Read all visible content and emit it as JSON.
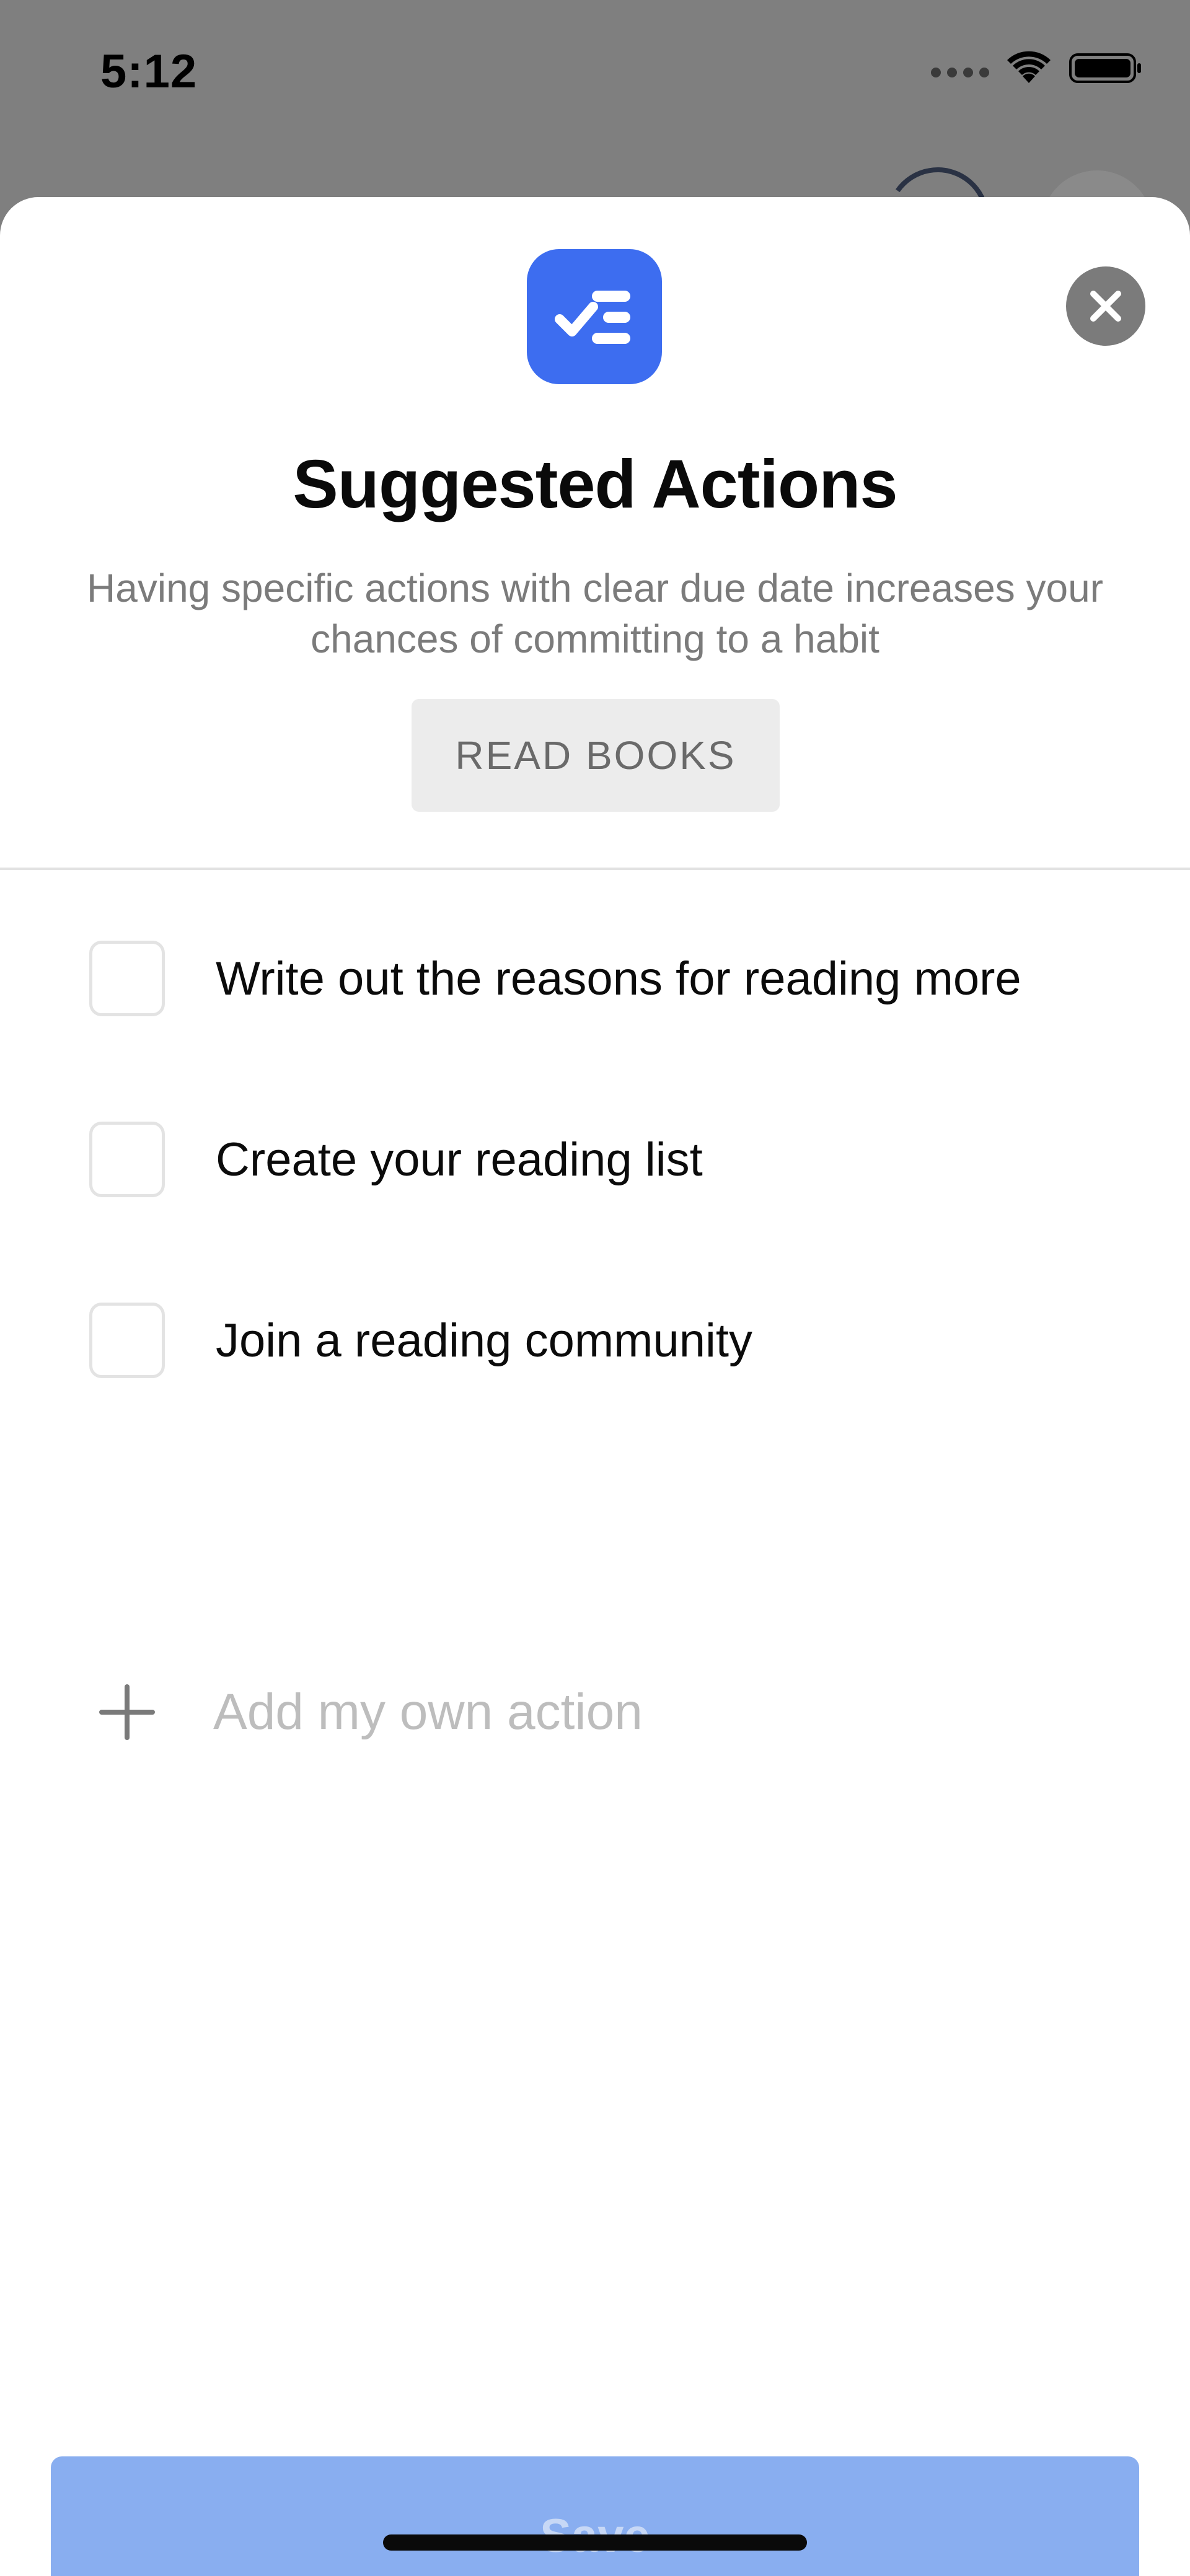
{
  "status_bar": {
    "time": "5:12",
    "icons": [
      "signal-dots-icon",
      "wifi-icon",
      "battery-icon"
    ]
  },
  "sheet": {
    "app_icon": "checklist-icon",
    "close_icon": "close-icon",
    "title": "Suggested Actions",
    "subtitle": "Having specific actions with clear due date increases your chances of committing to a habit",
    "tag": "READ BOOKS",
    "actions": [
      {
        "label": "Write out the reasons for reading more",
        "checked": false
      },
      {
        "label": "Create your reading list",
        "checked": false
      },
      {
        "label": "Join a reading community",
        "checked": false
      }
    ],
    "add_action": {
      "icon": "plus-icon",
      "placeholder": "Add my own action",
      "value": ""
    },
    "save_label": "Save"
  },
  "colors": {
    "accent": "#3d6df0",
    "save_disabled": "#89aef0",
    "overlay": "#7f7f7f"
  }
}
